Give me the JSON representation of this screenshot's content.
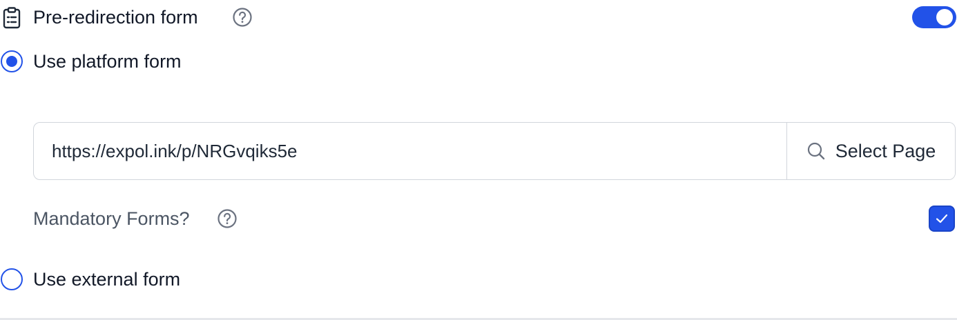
{
  "header": {
    "title": "Pre-redirection form",
    "icon": "clipboard-icon",
    "help_icon": "help-circle-icon",
    "toggle_on": true,
    "accent_color": "#2252e8"
  },
  "platform_option": {
    "label": "Use platform form",
    "selected": true
  },
  "form_url": {
    "value": "https://expol.ink/p/NRGvqiks5e",
    "button_label": "Select Page",
    "button_icon": "search-icon"
  },
  "mandatory": {
    "label": "Mandatory Forms?",
    "help_icon": "help-circle-icon",
    "checked": true
  },
  "external_option": {
    "label": "Use external form",
    "selected": false
  }
}
